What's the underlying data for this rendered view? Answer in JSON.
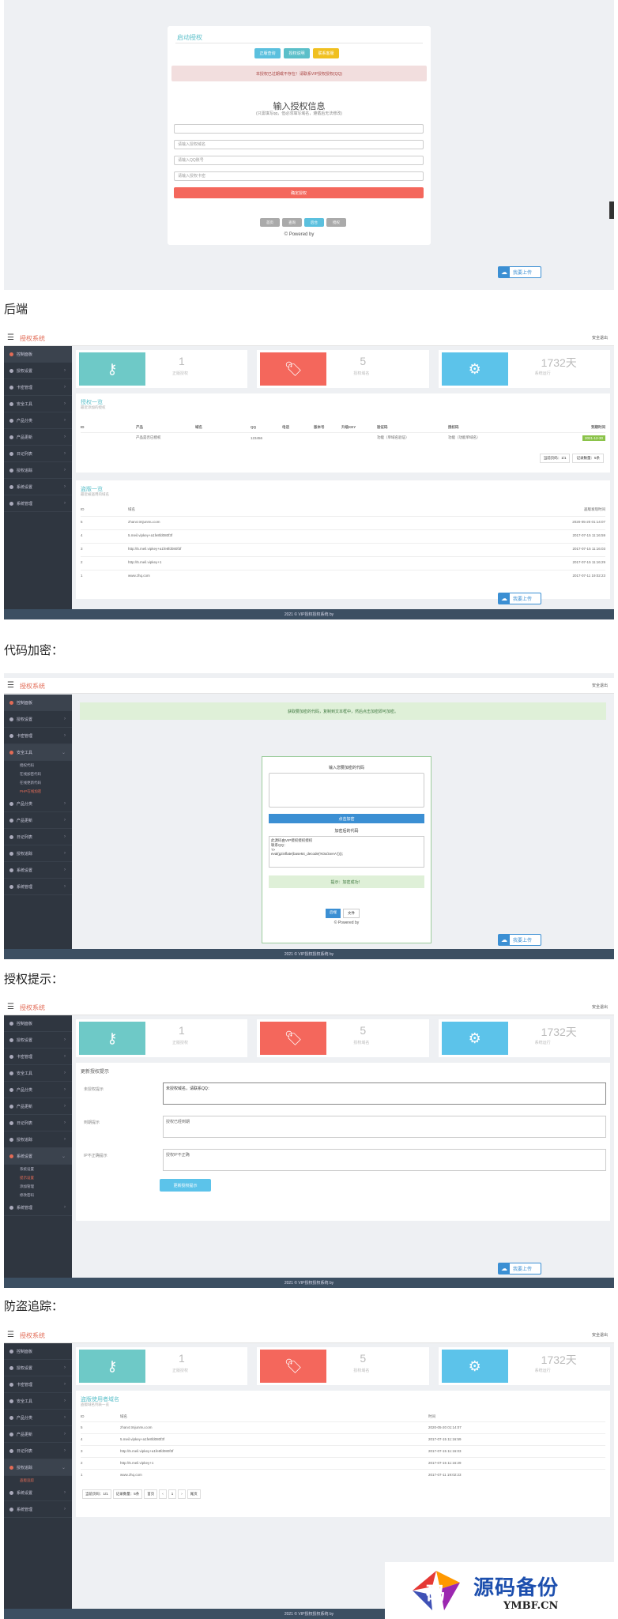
{
  "s1": {
    "title": "启动授权",
    "quick_buttons": [
      "正版查询",
      "授权说明",
      "联系客服"
    ],
    "alert": "本授权已过期或不存在！请联系VIP授权授权(QQ)",
    "heading": "输入授权信息",
    "subheading": "(只需填写qq，但必须填写域名，遵循后无法修改)",
    "inputs": [
      "",
      "请输入授权域名",
      "请输入QQ账号",
      "请输入授权卡密"
    ],
    "submit": "确定授权",
    "footer_buttons": [
      "首页",
      "查询",
      "后台",
      "授权"
    ],
    "powered": "© Powered by"
  },
  "upload_label": "我要上传",
  "captions": {
    "c1": "后端",
    "c2": "代码加密：",
    "c3": "授权提示：",
    "c4": "防盗追踪："
  },
  "brand": "授权系统",
  "exit": "安全退出",
  "footer": "2021 © VIP授权授权系统 by",
  "sidebar": [
    "控制面板",
    "授权设置",
    "卡密管理",
    "安全工具",
    "产品分类",
    "产品更新",
    "日记列表",
    "授权追踪",
    "系统设置",
    "系统管理"
  ],
  "stats": [
    {
      "value": "1",
      "label": "正版授权"
    },
    {
      "value": "5",
      "label": "授权域名"
    },
    {
      "value": "1732天",
      "label": "系统运行"
    }
  ],
  "s2": {
    "p1_title": "授权一览",
    "p1_sub": "最近添加的授权",
    "cols": [
      "ID",
      "产品",
      "域名",
      "QQ",
      "电话",
      "版本号",
      "升级KEY",
      "验证码",
      "授权码",
      "到期时间"
    ],
    "row": [
      "",
      "产品是否已授权",
      "",
      "123456",
      "",
      "",
      "",
      "功能（单域名验证）",
      "功能（功能单域名）",
      "2021-12-30"
    ],
    "p1_pager": [
      "当前页码：1/1",
      "记录数量：5条"
    ],
    "p2_title": "盗版一览",
    "p2_sub": "最近被盗用的域名",
    "cols2": [
      "ID",
      "域名",
      "盗版发现时间"
    ],
    "rows2": [
      [
        "5",
        "zhan4.tmjunmu.com",
        "2020-05-20 01:14:07"
      ],
      [
        "4",
        "5.meil.vipkey+a1fe8fd080f3f",
        "2017-07-15 11:16:59"
      ],
      [
        "3",
        "http://5.meil.vipkey+a1fe8fd080f3f",
        "2017-07-15 11:16:03"
      ],
      [
        "2",
        "http://5.meil.vipkey+1",
        "2017-07-15 11:16:29"
      ],
      [
        "1",
        "www.zhq.com",
        "2017-07-11 19:02:23"
      ]
    ]
  },
  "s3": {
    "notice": "获取要加密的代码，复制到文本框中，然后点击加密即可加密。",
    "title": "输入您要加密的代码",
    "btn": "点击加密",
    "result_title": "加密后的代码",
    "result": "此源码由VIP授权授权授权\n联系QQ：\n?>\neval(gzinflate(base64_decode('K0x/zwAA'))));",
    "ok": "提示：加密成功！",
    "buttons": [
      "后端",
      "文件"
    ],
    "powered": "© Powered by"
  },
  "s4": {
    "title": "更新授权提示",
    "labels": [
      "未授权提示",
      "到期提示",
      "IP不正确提示"
    ],
    "values": [
      "未授权域名，请联系QQ：",
      "授权已经到期",
      "授权IP不正确"
    ],
    "btn": "更新授权提示",
    "sub_items": [
      "系统设置",
      "提示设置",
      "添加管理",
      "修改密码"
    ]
  },
  "s5": {
    "title": "盗版使用者域名",
    "sub": "盗版域名列表一览",
    "cols": [
      "ID",
      "域名",
      "时间"
    ],
    "rows": [
      [
        "5",
        "zhan4.tmjunmu.com",
        "2020-05-20 01:14:07"
      ],
      [
        "4",
        "5.meil.vipkey+a1fe8fd080f3f",
        "2017-07-15 11:16:59"
      ],
      [
        "3",
        "http://5.meil.vipkey+a1fe8fd080f3f",
        "2017-07-15 11:16:03"
      ],
      [
        "2",
        "http://5.meil.vipkey+1",
        "2017-07-15 11:16:29"
      ],
      [
        "1",
        "www.zhq.com",
        "2017-07-11 19:02:23"
      ]
    ],
    "pager": [
      "当前页码：1/1",
      "记录数量：5条",
      "首页",
      "‹",
      "1",
      "›",
      "尾页"
    ],
    "sub_item": "盗版追踪"
  },
  "watermark": {
    "cn": "源码备份",
    "en": "YMBF.CN"
  },
  "colors": {
    "teal": "#6ec9c7",
    "red": "#f4675c",
    "blue": "#5cc3ea",
    "sidebar": "#2f3640",
    "brand": "#e26b56"
  }
}
